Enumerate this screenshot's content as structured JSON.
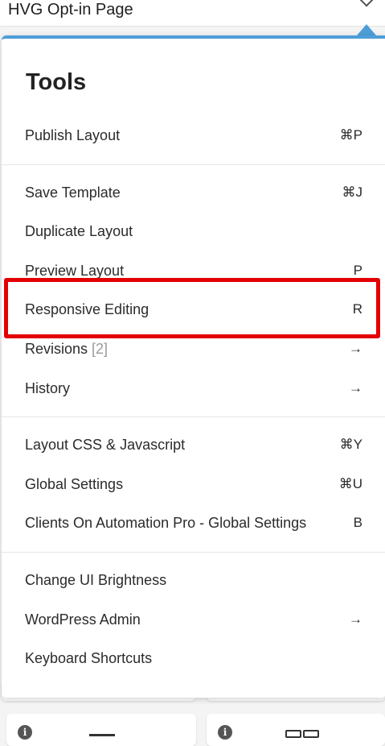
{
  "header": {
    "title": "HVG Opt-in Page"
  },
  "menu": {
    "title": "Tools",
    "groups": [
      [
        {
          "label": "Publish Layout",
          "shortcut": "⌘P"
        }
      ],
      [
        {
          "label": "Save Template",
          "shortcut": "⌘J"
        },
        {
          "label": "Duplicate Layout",
          "shortcut": ""
        },
        {
          "label": "Preview Layout",
          "shortcut": "P"
        },
        {
          "label": "Responsive Editing",
          "shortcut": "R"
        },
        {
          "label": "Revisions",
          "count": "[2]",
          "shortcut": "→"
        },
        {
          "label": "History",
          "shortcut": "→"
        }
      ],
      [
        {
          "label": "Layout CSS & Javascript",
          "shortcut": "⌘Y"
        },
        {
          "label": "Global Settings",
          "shortcut": "⌘U"
        },
        {
          "label": "Clients On Automation Pro - Global Settings",
          "shortcut": "B"
        }
      ],
      [
        {
          "label": "Change UI Brightness",
          "shortcut": ""
        },
        {
          "label": "WordPress Admin",
          "shortcut": "→"
        },
        {
          "label": "Keyboard Shortcuts",
          "shortcut": ""
        }
      ]
    ]
  },
  "colors": {
    "accent": "#4d9ed8",
    "highlight": "#e30000"
  }
}
